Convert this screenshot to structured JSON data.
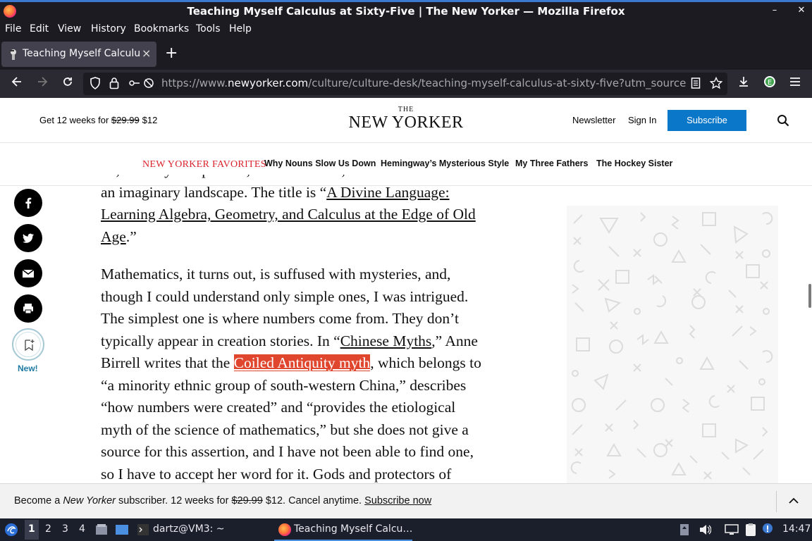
{
  "window": {
    "title": "Teaching Myself Calculus at Sixty-Five | The New Yorker — Mozilla Firefox",
    "controls": [
      "–",
      "✕"
    ]
  },
  "menubar": [
    "File",
    "Edit",
    "View",
    "History",
    "Bookmarks",
    "Tools",
    "Help"
  ],
  "tabs": [
    {
      "label": "Teaching Myself Calculus at Sixty-Five | The New Yorker",
      "close": "×"
    }
  ],
  "new_tab": "+",
  "url": {
    "prefix": "https://www.",
    "domain": "newyorker.com",
    "path": "/culture/culture-desk/teaching-myself-calculus-at-sixty-five?utm_source=pocket"
  },
  "header": {
    "promo_text": "Get 12 weeks for",
    "promo_old_price": "$29.99",
    "promo_new_price": "$12",
    "logo_small": "THE",
    "logo_name": "NEW YORKER",
    "newsletter": "Newsletter",
    "sign_in": "Sign In",
    "subscribe": "Subscribe"
  },
  "favorites": {
    "label": "NEW YORKER FAVORITES",
    "links": [
      "Why Nouns Slow Us Down",
      "Hemingway’s Mysterious Style",
      "My Three Fathers",
      "The Hockey Sister"
    ]
  },
  "share": {
    "new_label": "New!"
  },
  "article": {
    "p1_partial": "…, a lovely comparison, in other words, as if the book about an imaginary landscape. The title is “",
    "p1_link": "A Divine Language: Learning Algebra, Geometry, and Calculus at the Edge of Old Age",
    "p1_end": ".”",
    "p2_a": "Mathematics, it turns out, is suffused with mysteries, and, though I could understand only simple ones, I was intrigued. The simplest one is where numbers come from. They don’t typically appear in creation stories. In “",
    "p2_link1": "Chinese Myths",
    "p2_b": ",” Anne Birrell writes that the ",
    "p2_highlight": "Coiled Antiquity myth",
    "p2_c": ", which belongs to “a minority ethnic group of south-western China,” describes “how numbers were created” and “provides the etiological myth of the science of mathematics,” but she does not give a source for this assertion, and I have not been able to find one, so I have to accept her word for it. Gods and protectors of numbers"
  },
  "banner": {
    "text_a": "Become a ",
    "text_italic": "New Yorker",
    "text_b": " subscriber. 12 weeks for ",
    "old_price": "$29.99",
    "text_c": " $12. Cancel anytime. ",
    "link": "Subscribe now"
  },
  "taskbar": {
    "workspaces": [
      "1",
      "2",
      "3",
      "4"
    ],
    "terminal_task": "dartz@VM3: ~",
    "firefox_task": "Teaching Myself Calcu…",
    "clock": "14:47"
  },
  "colors": {
    "accent_red": "#d9232d",
    "subscribe_blue": "#0b77c9",
    "highlight": "#e0452d",
    "new_label": "#1e7aa3"
  }
}
